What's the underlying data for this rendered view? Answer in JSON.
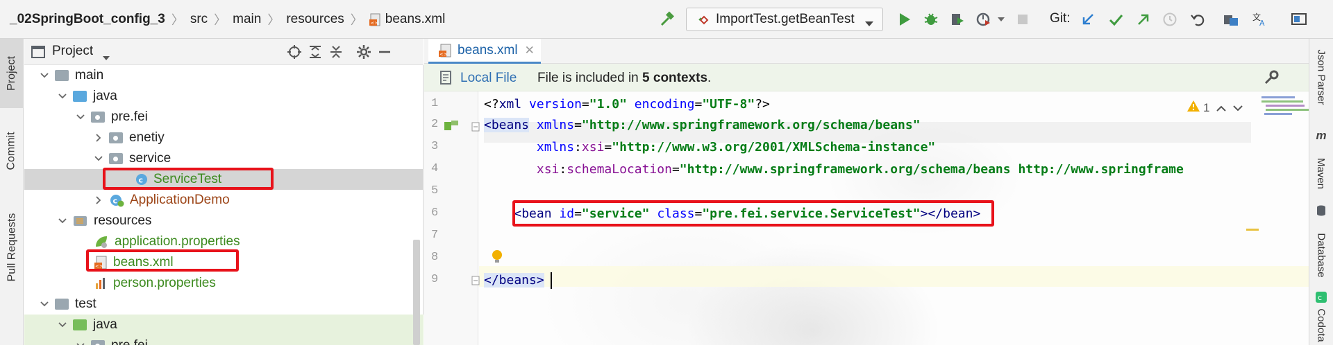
{
  "navbar": {
    "breadcrumbs": [
      "_02SpringBoot_config_3",
      "src",
      "main",
      "resources",
      "beans.xml"
    ],
    "run_config": "ImportTest.getBeanTest",
    "git_label": "Git:",
    "icons": [
      "hammer-icon",
      "run-icon",
      "debug-icon",
      "coverage-icon",
      "profile-icon",
      "stop-icon",
      "git-update-icon",
      "git-commit-icon",
      "git-push-icon",
      "history-icon",
      "rollback-icon",
      "project-structure-icon",
      "translate-icon",
      "presentation-icon"
    ]
  },
  "left_stripe": {
    "items": [
      "Project",
      "Commit",
      "Pull Requests"
    ]
  },
  "project_panel": {
    "title": "Project",
    "tree": [
      {
        "label": "main",
        "level": 1,
        "kind": "folder-gray",
        "expanded": true
      },
      {
        "label": "java",
        "level": 2,
        "kind": "folder-blue",
        "expanded": true
      },
      {
        "label": "pre.fei",
        "level": 3,
        "kind": "package",
        "expanded": true
      },
      {
        "label": "enetiy",
        "level": 4,
        "kind": "package",
        "expanded": false
      },
      {
        "label": "service",
        "level": 4,
        "kind": "package",
        "expanded": true
      },
      {
        "label": "ServiceTest",
        "level": 5,
        "kind": "class",
        "selected": true
      },
      {
        "label": "ApplicationDemo",
        "level": 4,
        "kind": "spring-class",
        "expanded": false
      },
      {
        "label": "resources",
        "level": 2,
        "kind": "folder-resources",
        "expanded": true
      },
      {
        "label": "application.properties",
        "level": 3,
        "kind": "spring-properties"
      },
      {
        "label": "beans.xml",
        "level": 3,
        "kind": "xml"
      },
      {
        "label": "person.properties",
        "level": 3,
        "kind": "properties"
      },
      {
        "label": "test",
        "level": 1,
        "kind": "folder-gray",
        "expanded": true
      },
      {
        "label": "java",
        "level": 2,
        "kind": "folder-green",
        "expanded": true
      },
      {
        "label": "pre.fei",
        "level": 3,
        "kind": "package",
        "expanded": true
      }
    ]
  },
  "editor": {
    "tab_label": "beans.xml",
    "banner_link": "Local File",
    "banner_prefix": "File is included in",
    "banner_bold": "5 contexts",
    "banner_suffix": ".",
    "warning_count": "1",
    "lines": [
      {
        "num": "1",
        "tokens": [
          [
            "pun",
            "<?"
          ],
          [
            "tag",
            "xml "
          ],
          [
            "attr",
            "version"
          ],
          [
            "pun",
            "="
          ],
          [
            "str",
            "\"1.0\""
          ],
          [
            "pun",
            " "
          ],
          [
            "attr",
            "encoding"
          ],
          [
            "pun",
            "="
          ],
          [
            "str",
            "\"UTF-8\""
          ],
          [
            "pun",
            "?>"
          ]
        ]
      },
      {
        "num": "2",
        "tokens": [
          [
            "tagbm",
            "<beans"
          ],
          [
            "pun",
            " "
          ],
          [
            "attr",
            "xmlns"
          ],
          [
            "pun",
            "="
          ],
          [
            "str",
            "\"http://www.springframework.org/schema/beans\""
          ]
        ]
      },
      {
        "num": "3",
        "tokens": [
          [
            "pun",
            "       "
          ],
          [
            "attr",
            "xmlns"
          ],
          [
            "pun",
            ":"
          ],
          [
            "ns",
            "xsi"
          ],
          [
            "pun",
            "="
          ],
          [
            "str",
            "\"http://www.w3.org/2001/XMLSchema-instance\""
          ]
        ]
      },
      {
        "num": "4",
        "tokens": [
          [
            "pun",
            "       "
          ],
          [
            "ns",
            "xsi"
          ],
          [
            "pun",
            ":"
          ],
          [
            "ns",
            "schemaLocation"
          ],
          [
            "pun",
            "="
          ],
          [
            "str",
            "\"http://www.springframework.org/schema/beans http://www.springframe"
          ]
        ]
      },
      {
        "num": "5",
        "tokens": []
      },
      {
        "num": "6",
        "tokens": [
          [
            "pun",
            "    "
          ],
          [
            "tag",
            "<bean "
          ],
          [
            "attr",
            "id"
          ],
          [
            "pun",
            "="
          ],
          [
            "str",
            "\"service\""
          ],
          [
            "pun",
            " "
          ],
          [
            "attr",
            "class"
          ],
          [
            "pun",
            "="
          ],
          [
            "str",
            "\"pre.fei.service.ServiceTest\""
          ],
          [
            "tag",
            "></bean>"
          ]
        ]
      },
      {
        "num": "7",
        "tokens": []
      },
      {
        "num": "8",
        "tokens": []
      },
      {
        "num": "9",
        "tokens": [
          [
            "tagbm",
            "</beans>"
          ]
        ]
      }
    ]
  },
  "right_stripe": {
    "items": [
      "Json Parser",
      "Maven",
      "Database",
      "Codota"
    ]
  },
  "colors": {
    "highlight_red": "#e8121a",
    "accent_blue": "#4a88c7",
    "string_green": "#067d17"
  }
}
